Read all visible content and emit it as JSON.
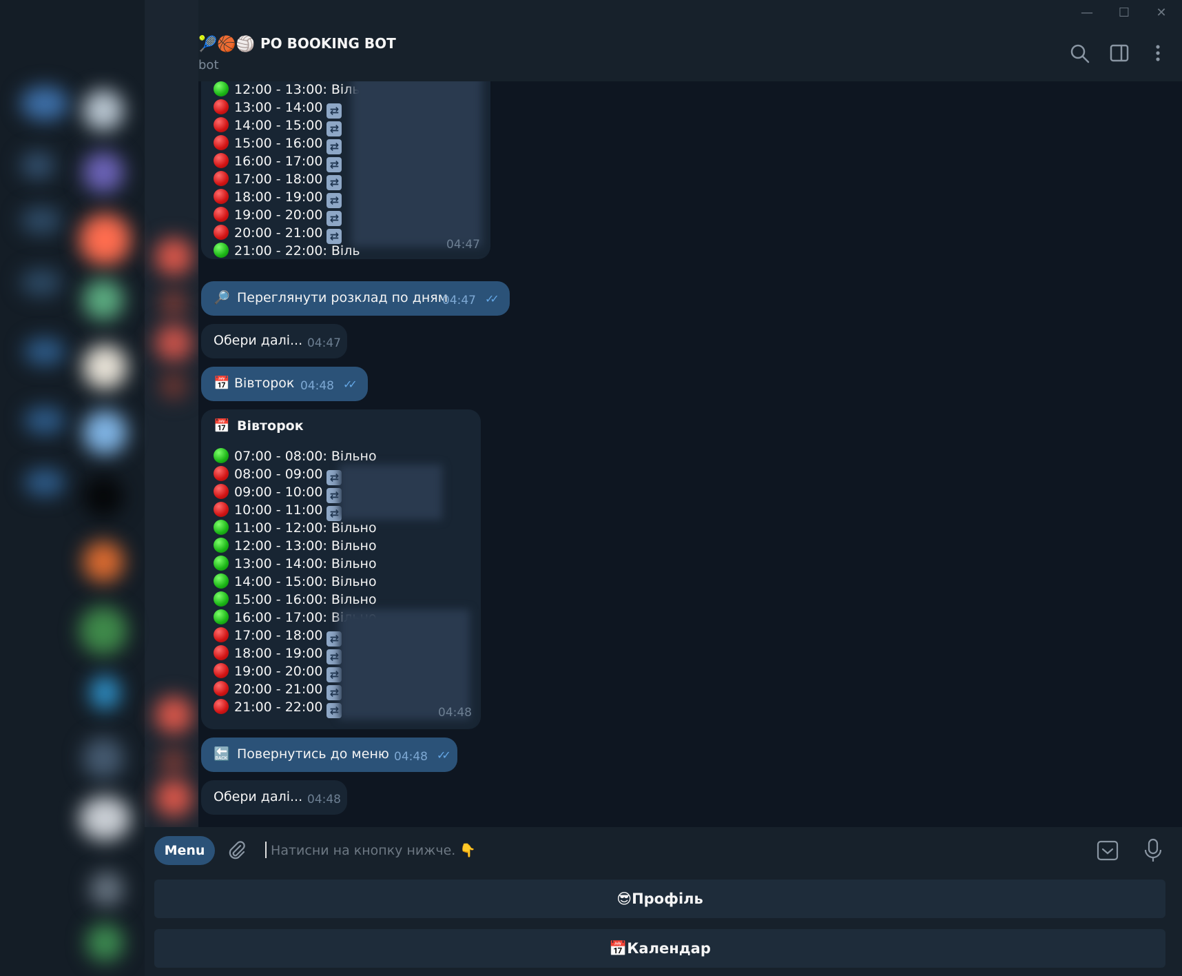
{
  "window": {
    "minimize": "—",
    "maximize": "☐",
    "close": "✕"
  },
  "header": {
    "emojis": "🎾🏀🏐",
    "title": "PO BOOKING BOT",
    "subtitle": "bot"
  },
  "messages": {
    "m1": {
      "slots": [
        {
          "time": "12:00 - 13:00:",
          "status": "Віль",
          "state": "free"
        },
        {
          "time": "13:00 - 14:00",
          "status": "",
          "state": "busy"
        },
        {
          "time": "14:00 - 15:00",
          "status": "",
          "state": "busy"
        },
        {
          "time": "15:00 - 16:00",
          "status": "",
          "state": "busy"
        },
        {
          "time": "16:00 - 17:00",
          "status": "",
          "state": "busy"
        },
        {
          "time": "17:00 - 18:00",
          "status": "",
          "state": "busy"
        },
        {
          "time": "18:00 - 19:00",
          "status": "",
          "state": "busy"
        },
        {
          "time": "19:00 - 20:00",
          "status": "",
          "state": "busy"
        },
        {
          "time": "20:00 - 21:00",
          "status": "",
          "state": "busy"
        },
        {
          "time": "21:00 - 22:00:",
          "status": "Віль",
          "state": "free"
        }
      ],
      "time": "04:47"
    },
    "m2": {
      "icon": "🔎",
      "text": "Переглянути розклад по дням",
      "time": "04:47"
    },
    "m3": {
      "text": "Обери далі...",
      "time": "04:47"
    },
    "m4": {
      "icon": "📅",
      "text": "Вівторок",
      "time": "04:48"
    },
    "m5": {
      "icon": "📅",
      "title": "Вівторок",
      "slots": [
        {
          "time": "07:00 - 08:00:",
          "status": "Вільно",
          "state": "free"
        },
        {
          "time": "08:00 - 09:00",
          "status": "",
          "state": "busy"
        },
        {
          "time": "09:00 - 10:00",
          "status": "",
          "state": "busy"
        },
        {
          "time": "10:00 - 11:00",
          "status": "",
          "state": "busy"
        },
        {
          "time": "11:00 - 12:00:",
          "status": "Вільно",
          "state": "free"
        },
        {
          "time": "12:00 - 13:00:",
          "status": "Вільно",
          "state": "free"
        },
        {
          "time": "13:00 - 14:00:",
          "status": "Вільно",
          "state": "free"
        },
        {
          "time": "14:00 - 15:00:",
          "status": "Вільно",
          "state": "free"
        },
        {
          "time": "15:00 - 16:00:",
          "status": "Вільно",
          "state": "free"
        },
        {
          "time": "16:00 - 17:00:",
          "status": "Вільно",
          "state": "free"
        },
        {
          "time": "17:00 - 18:00",
          "status": "",
          "state": "busy"
        },
        {
          "time": "18:00 - 19:00",
          "status": "",
          "state": "busy"
        },
        {
          "time": "19:00 - 20:00",
          "status": "",
          "state": "busy"
        },
        {
          "time": "20:00 - 21:00",
          "status": "",
          "state": "busy"
        },
        {
          "time": "21:00 - 22:00",
          "status": "",
          "state": "busy"
        }
      ],
      "time": "04:48"
    },
    "m6": {
      "icon": "🔙",
      "text": "Повернутись до меню",
      "time": "04:48"
    },
    "m7": {
      "text": "Обери далі...",
      "time": "04:48"
    }
  },
  "composer": {
    "menu_label": "Menu",
    "placeholder": "Натисни на кнопку нижче.",
    "placeholder_emoji": "👇"
  },
  "keyboard": {
    "profile_label": "😎Профіль",
    "calendar_label": "📅Календар"
  },
  "colors": {
    "free": "#1bb516",
    "busy": "#d11414",
    "accent": "#2b5278"
  }
}
